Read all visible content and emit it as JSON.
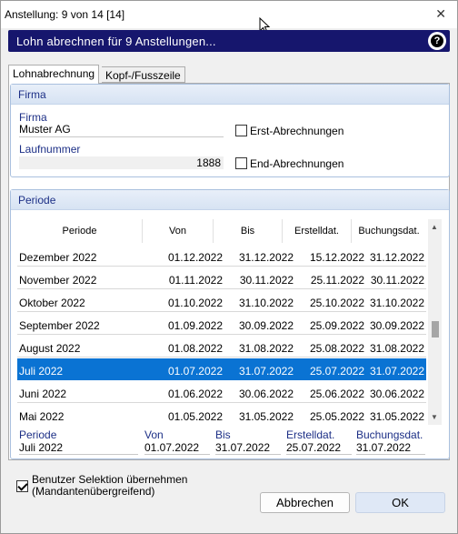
{
  "window": {
    "title": "Anstellung: 9 von 14 [14]",
    "close_glyph": "✕"
  },
  "banner": {
    "text": "Lohn abrechnen für 9 Anstellungen...",
    "help_glyph": "?",
    "color": "#16166d"
  },
  "tabs": [
    {
      "label": "Lohnabrechnung"
    },
    {
      "label": "Kopf-/Fusszeile"
    }
  ],
  "firma": {
    "group_title": "Firma",
    "firma_label": "Firma",
    "firma_value": "Muster AG",
    "laufnummer_label": "Laufnummer",
    "laufnummer_value": "1888",
    "erst_label": "Erst-Abrechnungen",
    "end_label": "End-Abrechnungen"
  },
  "periode": {
    "group_title": "Periode",
    "columns": [
      "Periode",
      "Von",
      "Bis",
      "Erstelldat.",
      "Buchungsdat."
    ],
    "rows": [
      [
        "Dezember 2022",
        "01.12.2022",
        "31.12.2022",
        "15.12.2022",
        "31.12.2022"
      ],
      [
        "November 2022",
        "01.11.2022",
        "30.11.2022",
        "25.11.2022",
        "30.11.2022"
      ],
      [
        "Oktober 2022",
        "01.10.2022",
        "31.10.2022",
        "25.10.2022",
        "31.10.2022"
      ],
      [
        "September 2022",
        "01.09.2022",
        "30.09.2022",
        "25.09.2022",
        "30.09.2022"
      ],
      [
        "August 2022",
        "01.08.2022",
        "31.08.2022",
        "25.08.2022",
        "31.08.2022"
      ],
      [
        "Juli 2022",
        "01.07.2022",
        "31.07.2022",
        "25.07.2022",
        "31.07.2022"
      ],
      [
        "Juni 2022",
        "01.06.2022",
        "30.06.2022",
        "25.06.2022",
        "30.06.2022"
      ],
      [
        "Mai 2022",
        "01.05.2022",
        "31.05.2022",
        "25.05.2022",
        "31.05.2022"
      ]
    ],
    "selected_index": 5,
    "detail": {
      "labels": [
        "Periode",
        "Von",
        "Bis",
        "Erstelldat.",
        "Buchungsdat."
      ],
      "values": [
        "Juli 2022",
        "01.07.2022",
        "31.07.2022",
        "25.07.2022",
        "31.07.2022"
      ]
    }
  },
  "footer": {
    "checkbox_label_line1": "Benutzer Selektion übernehmen",
    "checkbox_label_line2": "(Mandantenübergreifend)",
    "cancel_label": "Abbrechen",
    "ok_label": "OK"
  },
  "colors": {
    "selection": "#0a73d3",
    "label_blue": "#1c2f86"
  }
}
